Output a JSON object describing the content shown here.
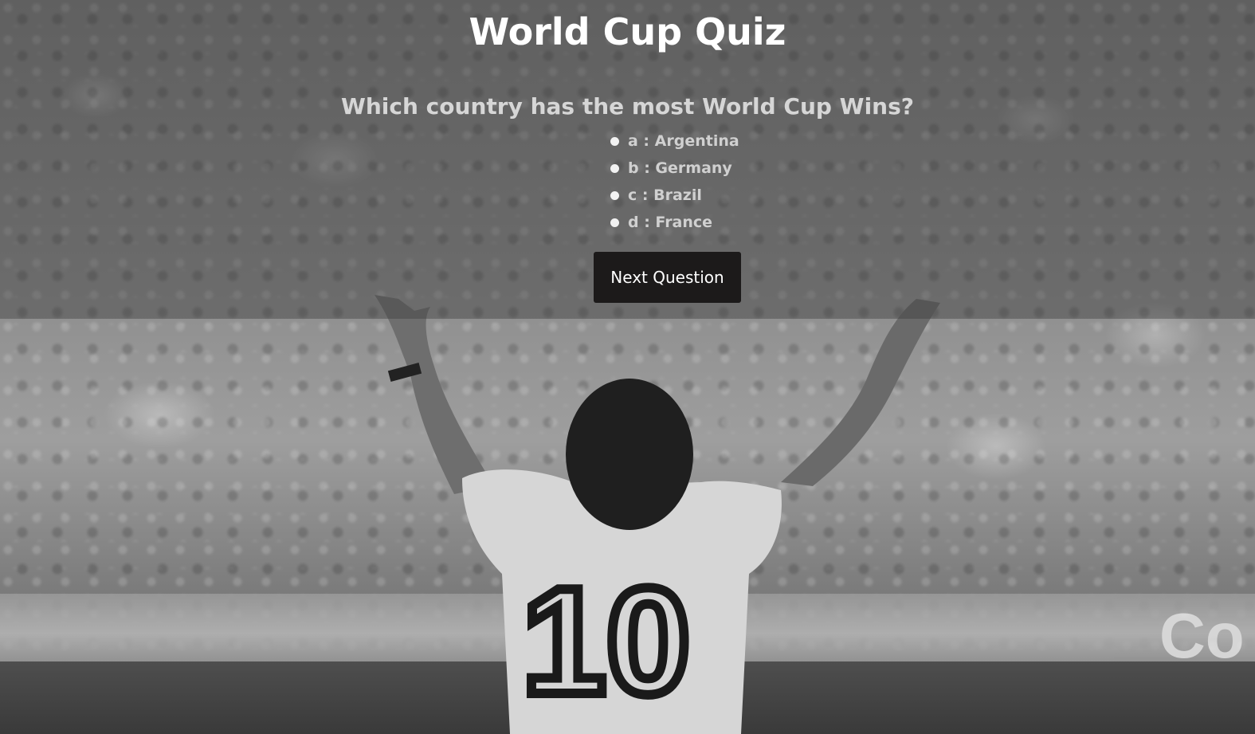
{
  "page": {
    "title": "World Cup Quiz"
  },
  "quiz": {
    "question": "Which country has the most World Cup Wins?",
    "answers": [
      {
        "key": "a",
        "text": "Argentina",
        "label": "a : Argentina"
      },
      {
        "key": "b",
        "text": "Germany",
        "label": "b : Germany"
      },
      {
        "key": "c",
        "text": "Brazil",
        "label": "c : Brazil"
      },
      {
        "key": "d",
        "text": "France",
        "label": "d : France"
      }
    ],
    "next_button_label": "Next Question"
  },
  "background": {
    "jersey_number": "10",
    "hoarding_text": "Co"
  },
  "colors": {
    "title": "#ffffff",
    "question": "#d6d6d6",
    "answer_text": "#d0d0d0",
    "bullet": "#f2f2f2",
    "button_bg": "#1c1a1a",
    "button_text": "#ffffff",
    "overlay": "rgba(60,60,60,0.42)"
  }
}
